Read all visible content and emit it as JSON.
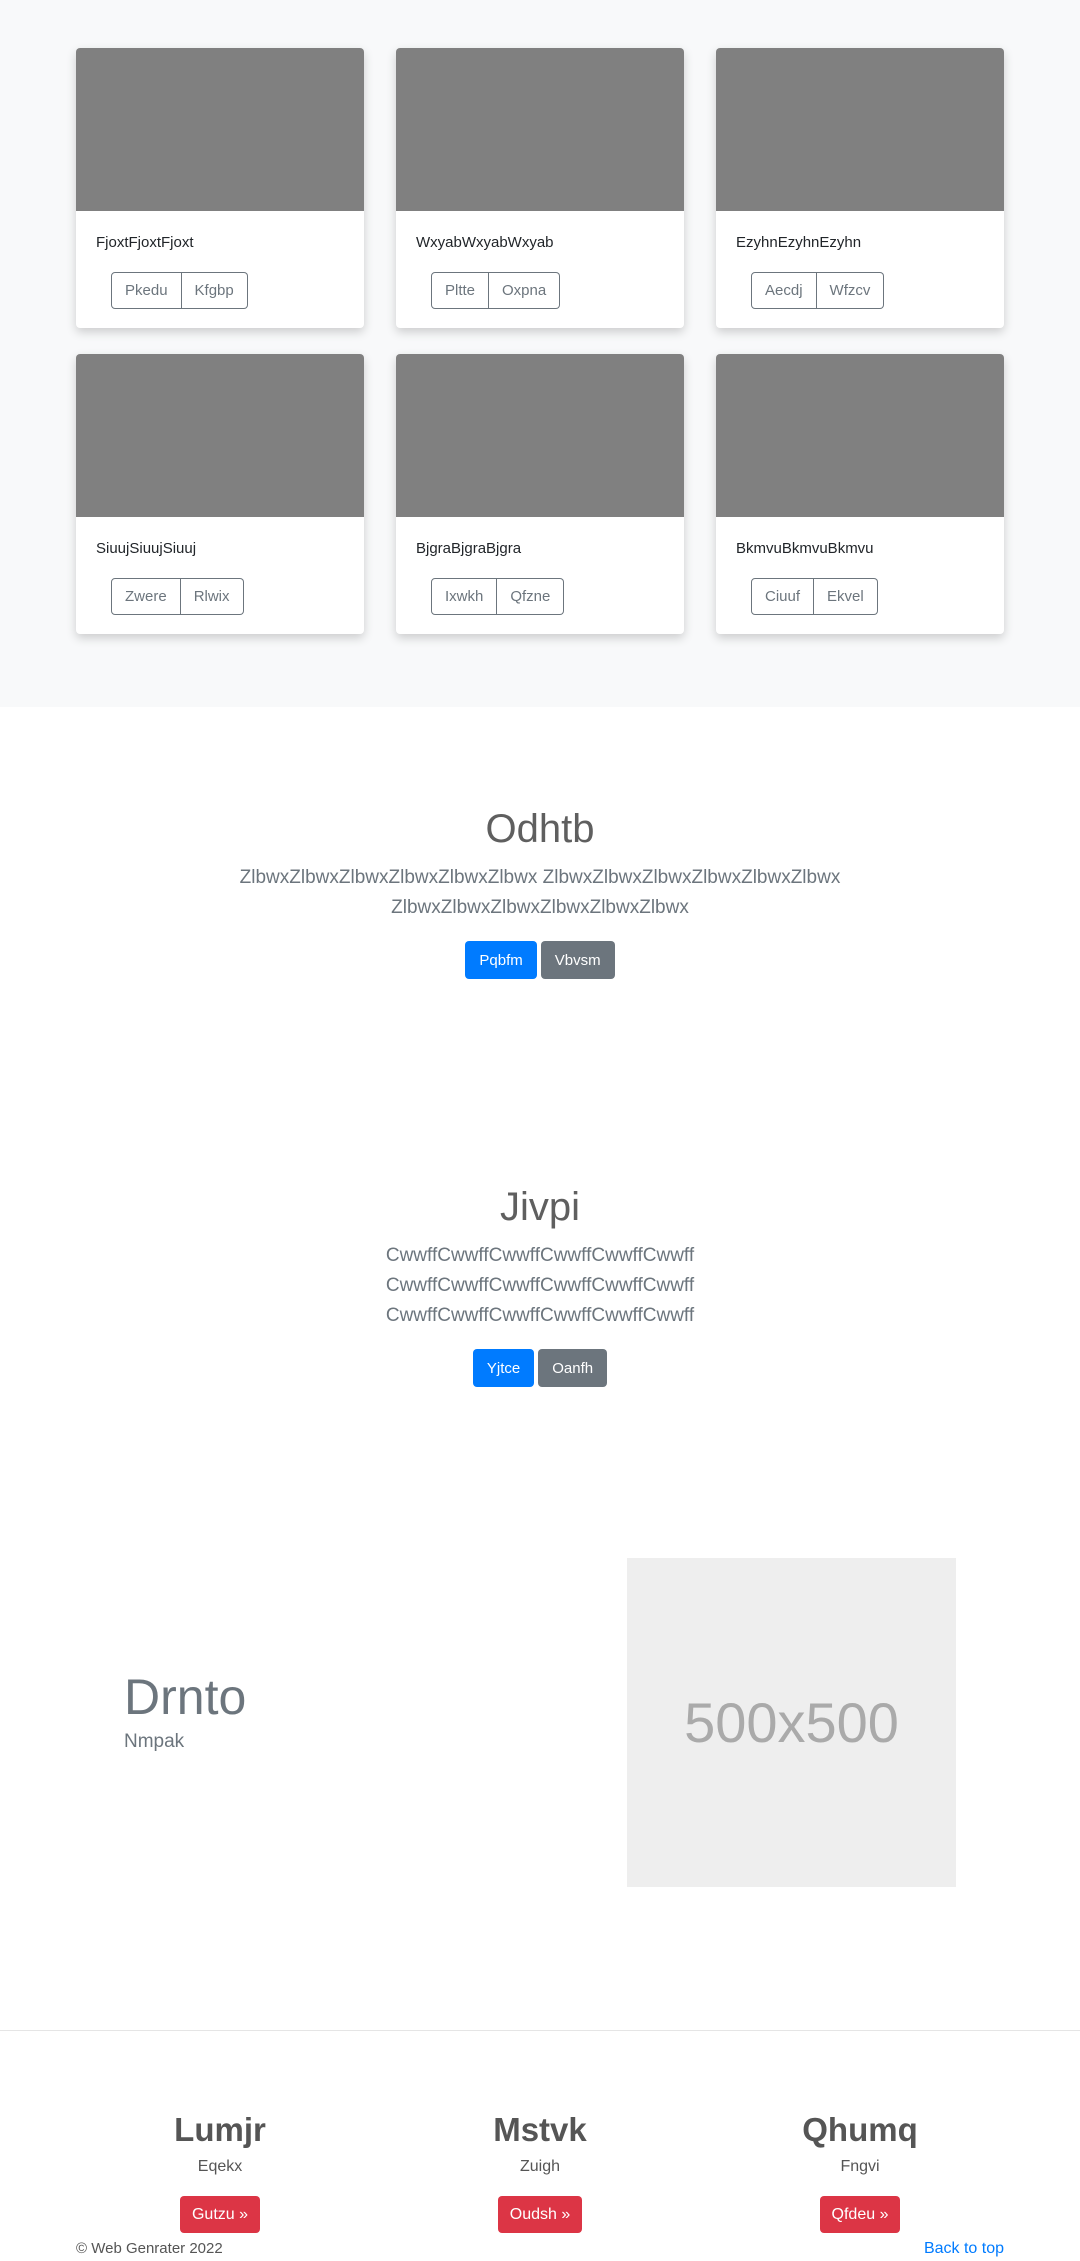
{
  "album": {
    "cards": [
      {
        "text": "FjoxtFjoxtFjoxt",
        "btn1": "Pkedu",
        "btn2": "Kfgbp"
      },
      {
        "text": "WxyabWxyabWxyab",
        "btn1": "Pltte",
        "btn2": "Oxpna"
      },
      {
        "text": "EzyhnEzyhnEzyhn",
        "btn1": "Aecdj",
        "btn2": "Wfzcv"
      },
      {
        "text": "SiuujSiuujSiuuj",
        "btn1": "Zwere",
        "btn2": "Rlwix"
      },
      {
        "text": "BjgraBjgraBjgra",
        "btn1": "Ixwkh",
        "btn2": "Qfzne"
      },
      {
        "text": "BkmvuBkmvuBkmvu",
        "btn1": "Ciuuf",
        "btn2": "Ekvel"
      }
    ]
  },
  "hero1": {
    "title": "Odhtb",
    "line1": "ZlbwxZlbwxZlbwxZlbwxZlbwxZlbwx ZlbwxZlbwxZlbwxZlbwxZlbwxZlbwx",
    "line2": "ZlbwxZlbwxZlbwxZlbwxZlbwxZlbwx",
    "primary": "Pqbfm",
    "secondary": "Vbvsm"
  },
  "hero2": {
    "title": "Jivpi",
    "line1": "CwwffCwwffCwwffCwwffCwwffCwwff",
    "line2": "CwwffCwwffCwwffCwwffCwwffCwwff",
    "line3": "CwwffCwwffCwwffCwwffCwwffCwwff",
    "primary": "Yjtce",
    "secondary": "Oanfh"
  },
  "feature": {
    "title": "Drnto",
    "subtitle": "Nmpak",
    "placeholder": "500x500"
  },
  "footer": {
    "columns": [
      {
        "title": "Lumjr",
        "text": "Eqekx",
        "button": "Gutzu »"
      },
      {
        "title": "Mstvk",
        "text": "Zuigh",
        "button": "Oudsh »"
      },
      {
        "title": "Qhumq",
        "text": "Fngvi",
        "button": "Qfdeu »"
      }
    ],
    "copyright": "© Web Genrater 2022",
    "back_to_top": "Back to top"
  }
}
